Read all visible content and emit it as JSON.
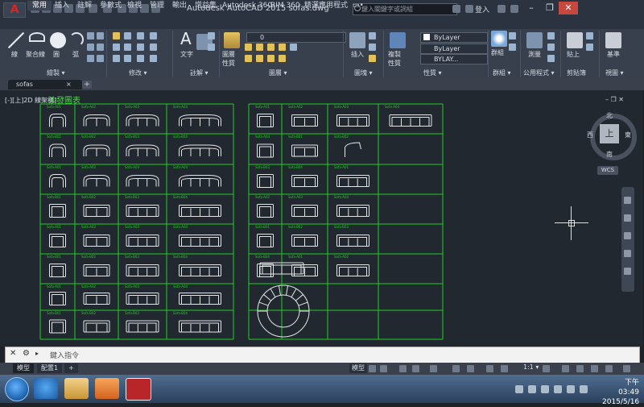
{
  "titlebar": {
    "app_button": "A",
    "title": "Autodesk AutoCAD 2015    sofas.dwg",
    "search_placeholder": "鍵入關鍵字或詞組",
    "login": "登入",
    "min": "–",
    "max": "❐",
    "close": "✕"
  },
  "ribbon_tabs": [
    "常用",
    "插入",
    "註解",
    "參數式",
    "檢視",
    "管理",
    "輸出",
    "增益集",
    "Autodesk 360",
    "BIM 360",
    "精選應用程式",
    "▭•"
  ],
  "ribbon": {
    "draw": {
      "line": "線",
      "polyline": "聚合線",
      "circle": "圓",
      "arc": "弧",
      "panel": "繪製 ▾"
    },
    "modify": {
      "panel": "修改 ▾"
    },
    "annotation": {
      "text": "文字",
      "dimension": "",
      "panel": "註解 ▾"
    },
    "layers": {
      "layer_props": "圖層\n性質",
      "layer_dropdown": "0",
      "panel": "圖層 ▾"
    },
    "block": {
      "insert": "插入",
      "panel": "圖塊 ▾"
    },
    "properties": {
      "match": "複製\n性質",
      "color": "ByLayer",
      "linetype": "ByLayer",
      "lineweight": "BYLAY...",
      "panel": "性質 ▾"
    },
    "groups": {
      "group": "群組",
      "panel": "群組 ▾"
    },
    "utilities": {
      "measure": "測量",
      "panel": "公用程式 ▾"
    },
    "clipboard": {
      "paste": "貼上",
      "panel": "剪貼簿"
    },
    "view": {
      "base": "基準",
      "panel": "視圖 ▾"
    }
  },
  "doc_tab": {
    "name": "sofas",
    "close": "×",
    "new": "+"
  },
  "viewport": {
    "label": "[-][上]2D 線架構]",
    "sheet_title": "沙發圖表",
    "controls": "– ❐ ✕"
  },
  "viewcube": {
    "north": "北",
    "south": "南",
    "east": "東",
    "west": "西",
    "face": "上",
    "wcs": "WCS"
  },
  "cmdline": {
    "close": "✕",
    "settings": "🔧",
    "prompt": "▸",
    "placeholder": "鍵入指令"
  },
  "layout_tabs": [
    "模型",
    "配置1",
    "+"
  ],
  "status": {
    "model": "模型",
    "scale": "1:1 ▾"
  },
  "clock": {
    "time": "下午 03:49",
    "date": "2015/5/16"
  },
  "grid_color": "#1fcf1f",
  "cell_labels": [
    "Sofa-A01",
    "Sofa-A02",
    "Sofa-A03",
    "Sofa-A04",
    "Sofa-B01",
    "Sofa-B02",
    "Sofa-B03",
    "Sofa-B04"
  ]
}
